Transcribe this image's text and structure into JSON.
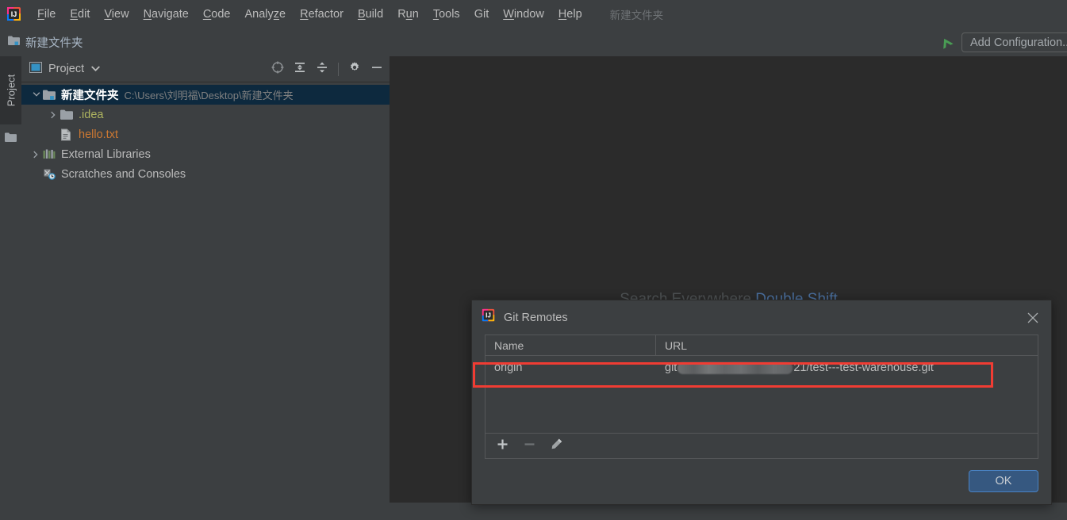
{
  "app": {
    "menu_items": [
      {
        "label": "File",
        "mnemonic": "F"
      },
      {
        "label": "Edit",
        "mnemonic": "E"
      },
      {
        "label": "View",
        "mnemonic": "V"
      },
      {
        "label": "Navigate",
        "mnemonic": "N"
      },
      {
        "label": "Code",
        "mnemonic": "C"
      },
      {
        "label": "Analyze",
        "mnemonic": "z"
      },
      {
        "label": "Refactor",
        "mnemonic": "R"
      },
      {
        "label": "Build",
        "mnemonic": "B"
      },
      {
        "label": "Run",
        "mnemonic": "u"
      },
      {
        "label": "Tools",
        "mnemonic": "T"
      },
      {
        "label": "Git",
        "mnemonic": ""
      },
      {
        "label": "Window",
        "mnemonic": "W"
      },
      {
        "label": "Help",
        "mnemonic": "H"
      }
    ],
    "project_name_faded": "新建文件夹"
  },
  "navbar": {
    "breadcrumb": "新建文件夹",
    "folder_icon": "folder-icon",
    "run_icon": "run-arrow-icon",
    "add_configuration_label": "Add Configuration..."
  },
  "tool_strip": {
    "tab_label": "Project",
    "folder_icon": "folder-icon"
  },
  "project_panel": {
    "title": "Project",
    "window_icon": "project-window-icon",
    "caret_icon": "chevron-down-icon",
    "actions": [
      {
        "name": "select-opened-file-icon"
      },
      {
        "name": "expand-all-icon"
      },
      {
        "name": "collapse-all-icon"
      },
      {
        "name": "gear-icon"
      },
      {
        "name": "hide-icon"
      }
    ],
    "tree": [
      {
        "label": "新建文件夹",
        "path": "C:\\Users\\刘明福\\Desktop\\新建文件夹",
        "icon": "project-folder-icon",
        "toggle": "chevron-down-icon",
        "indent": 0,
        "selected": true,
        "style": "bold"
      },
      {
        "label": ".idea",
        "path": "",
        "icon": "folder-icon",
        "toggle": "chevron-right-icon",
        "indent": 1,
        "selected": false,
        "style": "folder"
      },
      {
        "label": "hello.txt",
        "path": "",
        "icon": "text-file-icon",
        "toggle": "",
        "indent": 1,
        "selected": false,
        "style": "txt"
      },
      {
        "label": "External Libraries",
        "path": "",
        "icon": "libraries-icon",
        "toggle": "chevron-right-icon",
        "indent": 0,
        "selected": false,
        "style": "normal"
      },
      {
        "label": "Scratches and Consoles",
        "path": "",
        "icon": "scratches-icon",
        "toggle": "",
        "indent": 0,
        "selected": false,
        "style": "normal"
      }
    ]
  },
  "editor": {
    "watermark_text": "Search Everywhere",
    "watermark_shortcut": "Double Shift"
  },
  "dialog": {
    "title": "Git Remotes",
    "icon": "intellij-logo-icon",
    "close_icon": "close-icon",
    "table": {
      "columns": [
        "Name",
        "URL"
      ],
      "rows": [
        {
          "name": "origin",
          "url_prefix": "git",
          "url_redacted": "redacted-host",
          "url_suffix": "21/test---test-warehouse.git",
          "highlighted": true
        }
      ]
    },
    "toolbar": [
      {
        "name": "add-remote-button",
        "glyph": "+",
        "enabled": true
      },
      {
        "name": "remove-remote-button",
        "glyph": "−",
        "enabled": false
      },
      {
        "name": "edit-remote-button",
        "glyph": "pencil-icon",
        "enabled": true
      }
    ],
    "ok_label": "OK"
  },
  "colors": {
    "window_bg": "#3c3f41",
    "editor_bg": "#2b2b2b",
    "selection_blue": "#0d293e",
    "accent_blue": "#365880",
    "annotation_red": "#f03c33",
    "text": "#bbbbbb",
    "txt_file_orange": "#cc7832",
    "folder_yellow": "#afb560"
  }
}
